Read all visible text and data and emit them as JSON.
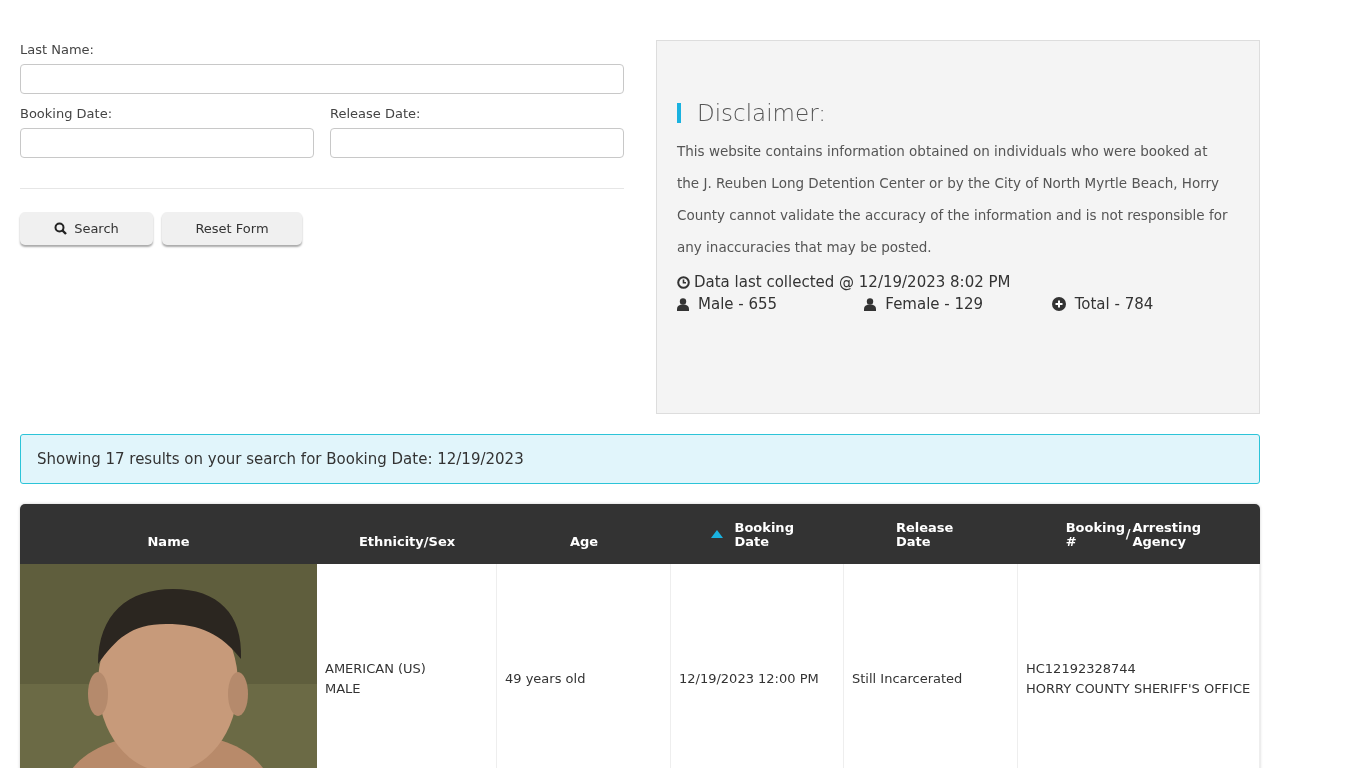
{
  "search_form": {
    "fields": [
      {
        "label": "Last Name:",
        "kind": "wide"
      },
      {
        "label": "Booking Date:",
        "kind": "half"
      },
      {
        "label": "Release Date:",
        "kind": "half"
      }
    ],
    "buttons": [
      {
        "label": "Search",
        "kind": "search"
      },
      {
        "label": "Reset Form",
        "kind": "plain"
      }
    ]
  },
  "disclaimer": {
    "title": "Disclaimer:",
    "text": "This website contains information obtained on individuals who were booked at the J. Reuben Long Detention Center or by the City of North Myrtle Beach, Horry County cannot validate the accuracy of the information and is not responsible for any inaccuracies that may be posted.",
    "last_collected": "Data last collected @ 12/19/2023 8:02 PM",
    "stats": [
      {
        "label": "Male - 655",
        "kind": "person"
      },
      {
        "label": "Female - 129",
        "kind": "person"
      },
      {
        "label": "Total - 784",
        "kind": "total"
      }
    ]
  },
  "results_notice": "Showing 17 results on your search for Booking Date: 12/19/2023",
  "table": {
    "columns": [
      {
        "label": "Name",
        "sorted": false
      },
      {
        "label": "Ethnicity/Sex",
        "sorted": false
      },
      {
        "label": "Age",
        "sorted": false
      },
      {
        "label": "Booking Date",
        "sorted": true
      },
      {
        "label": "Release Date",
        "sorted": false
      },
      {
        "label": "Booking #",
        "separator": "/",
        "label_2": "Arresting Agency",
        "sorted": false
      }
    ],
    "rows": [
      {
        "ethnicity": "AMERICAN (US)",
        "sex": "MALE",
        "age": "49 years old",
        "booking_date": "12/19/2023 12:00 PM",
        "release_date": "Still Incarcerated",
        "booking_number": "HC12192328744",
        "agency": "HORRY COUNTY SHERIFF'S OFFICE"
      }
    ]
  }
}
